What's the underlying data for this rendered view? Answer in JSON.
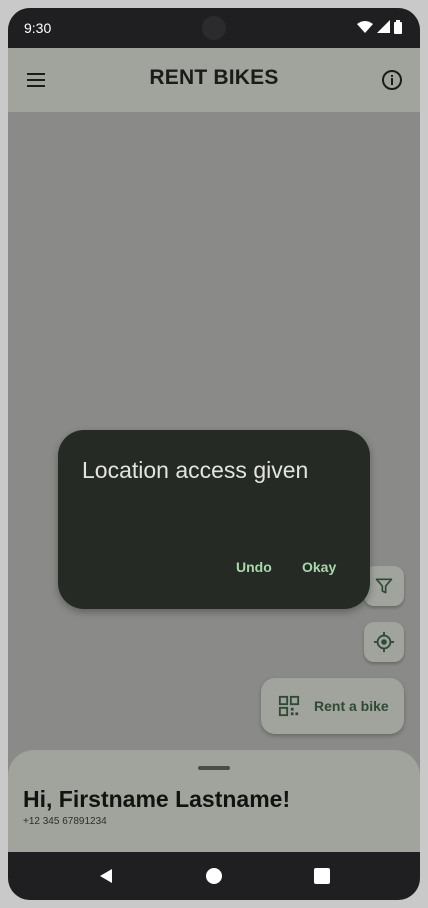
{
  "status_bar": {
    "time": "9:30",
    "icons": [
      "wifi-icon",
      "signal-icon",
      "battery-icon"
    ]
  },
  "app_bar": {
    "title": "RENT BIKES",
    "menu_icon": "menu-icon",
    "info_icon": "info-icon"
  },
  "fabs": {
    "filter_icon": "filter-icon",
    "location_icon": "my-location-icon",
    "rent_label": "Rent a bike",
    "rent_icon": "qr-code-icon"
  },
  "snackbar": {
    "message": "Location access given",
    "undo_label": "Undo",
    "okay_label": "Okay"
  },
  "bottom_sheet": {
    "greeting": "Hi, Firstname Lastname!",
    "phone": "+12 345 67891234"
  },
  "nav_bar": {
    "buttons": [
      "back-icon",
      "home-icon",
      "recents-icon"
    ]
  },
  "colors": {
    "surface": "#a0a49d",
    "snackbar": "#252a25",
    "accent_text": "#a8d8ab",
    "scrim": "#8a8b89"
  }
}
